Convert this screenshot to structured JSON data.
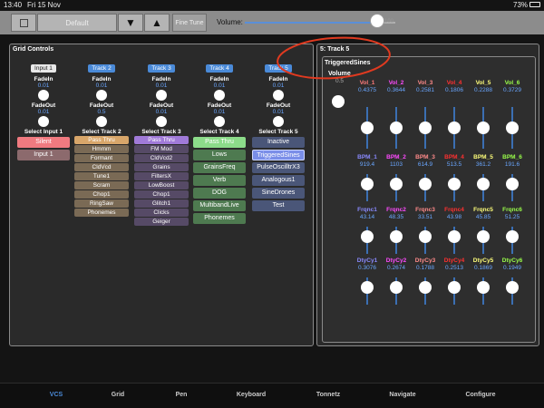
{
  "status": {
    "time": "13:40",
    "date": "Fri 15 Nov",
    "battery": "73%"
  },
  "toolbar": {
    "preset": "Default",
    "down": "▼",
    "up": "▲",
    "finetune": "Fine Tune",
    "volume_label": "Volume:",
    "volume_value": "100",
    "volume_level": 0.88
  },
  "grid": {
    "title": "Grid Controls",
    "columns": [
      {
        "header": "Input 1",
        "header_color": "#e8e8e8",
        "fadein_label": "FadeIn",
        "fadein": "0.01",
        "fadeout_label": "FadeOut",
        "fadeout": "0.01",
        "select_label": "Select Input 1",
        "options": [
          {
            "label": "Silent",
            "color": "#f07a80"
          },
          {
            "label": "Input 1",
            "color": "#8c6a6d"
          }
        ],
        "style": "pill"
      },
      {
        "header": "Track 2",
        "header_color": "#4a8ad8",
        "fadein_label": "FadeIn",
        "fadein": "0.01",
        "fadeout_label": "FadeOut",
        "fadeout": "0.5",
        "select_label": "Select Track 2",
        "options": [
          {
            "label": "Pass Thru",
            "color": "#d8a66a"
          },
          {
            "label": "Hmmm",
            "color": "#7a6a55"
          },
          {
            "label": "Formant",
            "color": "#7a6a55"
          },
          {
            "label": "CldVcd",
            "color": "#7a6a55"
          },
          {
            "label": "Tune1",
            "color": "#7a6a55"
          },
          {
            "label": "Scram",
            "color": "#7a6a55"
          },
          {
            "label": "Chop1",
            "color": "#7a6a55"
          },
          {
            "label": "RingSaw",
            "color": "#7a6a55"
          },
          {
            "label": "Phonemes",
            "color": "#7a6a55"
          }
        ],
        "style": "opt"
      },
      {
        "header": "Track 3",
        "header_color": "#4a8ad8",
        "fadein_label": "FadeIn",
        "fadein": "0.01",
        "fadeout_label": "FadeOut",
        "fadeout": "0.01",
        "select_label": "Select Track 3",
        "options": [
          {
            "label": "Pass Thru",
            "color": "#a07ad8"
          },
          {
            "label": "FM Mod",
            "color": "#564a66"
          },
          {
            "label": "CldVcd2",
            "color": "#564a66"
          },
          {
            "label": "Grains",
            "color": "#564a66"
          },
          {
            "label": "FiltersX",
            "color": "#564a66"
          },
          {
            "label": "LowBoost",
            "color": "#564a66"
          },
          {
            "label": "Chop1",
            "color": "#564a66"
          },
          {
            "label": "Glitch1",
            "color": "#564a66"
          },
          {
            "label": "Clicks",
            "color": "#564a66"
          },
          {
            "label": "Geiger",
            "color": "#564a66"
          }
        ],
        "style": "opt"
      },
      {
        "header": "Track 4",
        "header_color": "#4a8ad8",
        "fadein_label": "FadeIn",
        "fadein": "0.01",
        "fadeout_label": "FadeOut",
        "fadeout": "0.01",
        "select_label": "Select Track 4",
        "options": [
          {
            "label": "Pass Thru",
            "color": "#8cdc8a"
          },
          {
            "label": "Lows",
            "color": "#4e7a50"
          },
          {
            "label": "GrainsFreq",
            "color": "#4e7a50"
          },
          {
            "label": "Verb",
            "color": "#4e7a50"
          },
          {
            "label": "DOG",
            "color": "#4e7a50"
          },
          {
            "label": "MultibandLive",
            "color": "#4e7a50"
          },
          {
            "label": "Phonemes",
            "color": "#4e7a50"
          }
        ],
        "style": "pill"
      },
      {
        "header": "Track 5",
        "header_color": "#4a8ad8",
        "fadein_label": "FadeIn",
        "fadein": "0.01",
        "fadeout_label": "FadeOut",
        "fadeout": "0.01",
        "select_label": "Select Track 5",
        "options": [
          {
            "label": "Inactive",
            "color": "#4a5678"
          },
          {
            "label": "TriggeredSines",
            "color": "#7a8ee8"
          },
          {
            "label": "PulseOscilltrX3",
            "color": "#4a5678"
          },
          {
            "label": "Analogous1",
            "color": "#4a5678"
          },
          {
            "label": "SineDrones",
            "color": "#4a5678"
          },
          {
            "label": "Test",
            "color": "#4a5678"
          }
        ],
        "style": "pill"
      }
    ]
  },
  "track5": {
    "title": "5: Track 5",
    "synth_title": "TriggeredSines",
    "volume_label": "Volume",
    "volume_value": "0.5",
    "rows": [
      {
        "items": [
          {
            "label": "Vol_1",
            "value": "0.4375",
            "color": "#ff7a7a"
          },
          {
            "label": "Vol_2",
            "value": "0.3644",
            "color": "#ff4aff"
          },
          {
            "label": "Vol_3",
            "value": "0.2581",
            "color": "#ff8a8a"
          },
          {
            "label": "Vol_4",
            "value": "0.1806",
            "color": "#ff3030"
          },
          {
            "label": "Vol_5",
            "value": "0.2288",
            "color": "#ffff7a"
          },
          {
            "label": "Vol_6",
            "value": "0.3729",
            "color": "#9aff4a"
          }
        ]
      },
      {
        "items": [
          {
            "label": "BPM_1",
            "value": "919.4",
            "color": "#8a8aff"
          },
          {
            "label": "BPM_2",
            "value": "1103",
            "color": "#ff4aff"
          },
          {
            "label": "BPM_3",
            "value": "614.9",
            "color": "#ff8a8a"
          },
          {
            "label": "BPM_4",
            "value": "513.5",
            "color": "#ff3030"
          },
          {
            "label": "BPM_5",
            "value": "361.2",
            "color": "#ffff7a"
          },
          {
            "label": "BPM_6",
            "value": "191.6",
            "color": "#9aff4a"
          }
        ]
      },
      {
        "items": [
          {
            "label": "Frqnc1",
            "value": "43.14",
            "color": "#8a8aff"
          },
          {
            "label": "Frqnc2",
            "value": "48.35",
            "color": "#ff4aff"
          },
          {
            "label": "Frqnc3",
            "value": "33.51",
            "color": "#ff8a8a"
          },
          {
            "label": "Frqnc4",
            "value": "43.98",
            "color": "#ff3030"
          },
          {
            "label": "Frqnc5",
            "value": "45.85",
            "color": "#ffff7a"
          },
          {
            "label": "Frqnc6",
            "value": "51.25",
            "color": "#9aff4a"
          }
        ]
      },
      {
        "items": [
          {
            "label": "DtyCy1",
            "value": "0.3076",
            "color": "#8a8aff"
          },
          {
            "label": "DtyCy2",
            "value": "0.2674",
            "color": "#ff4aff"
          },
          {
            "label": "DtyCy3",
            "value": "0.1788",
            "color": "#ff8a8a"
          },
          {
            "label": "DtyCy4",
            "value": "0.2513",
            "color": "#ff3030"
          },
          {
            "label": "DtyCy5",
            "value": "0.1869",
            "color": "#ffff7a"
          },
          {
            "label": "DtyCy6",
            "value": "0.1949",
            "color": "#9aff4a"
          }
        ]
      }
    ]
  },
  "tabs": [
    {
      "label": "VCS",
      "active": true
    },
    {
      "label": "Grid"
    },
    {
      "label": "Pen"
    },
    {
      "label": "Keyboard"
    },
    {
      "label": "Tonnetz"
    },
    {
      "label": "Navigate"
    },
    {
      "label": "Configure"
    }
  ],
  "colors": {
    "accent": "#4a8ad8",
    "annotation": "#e03a20"
  }
}
